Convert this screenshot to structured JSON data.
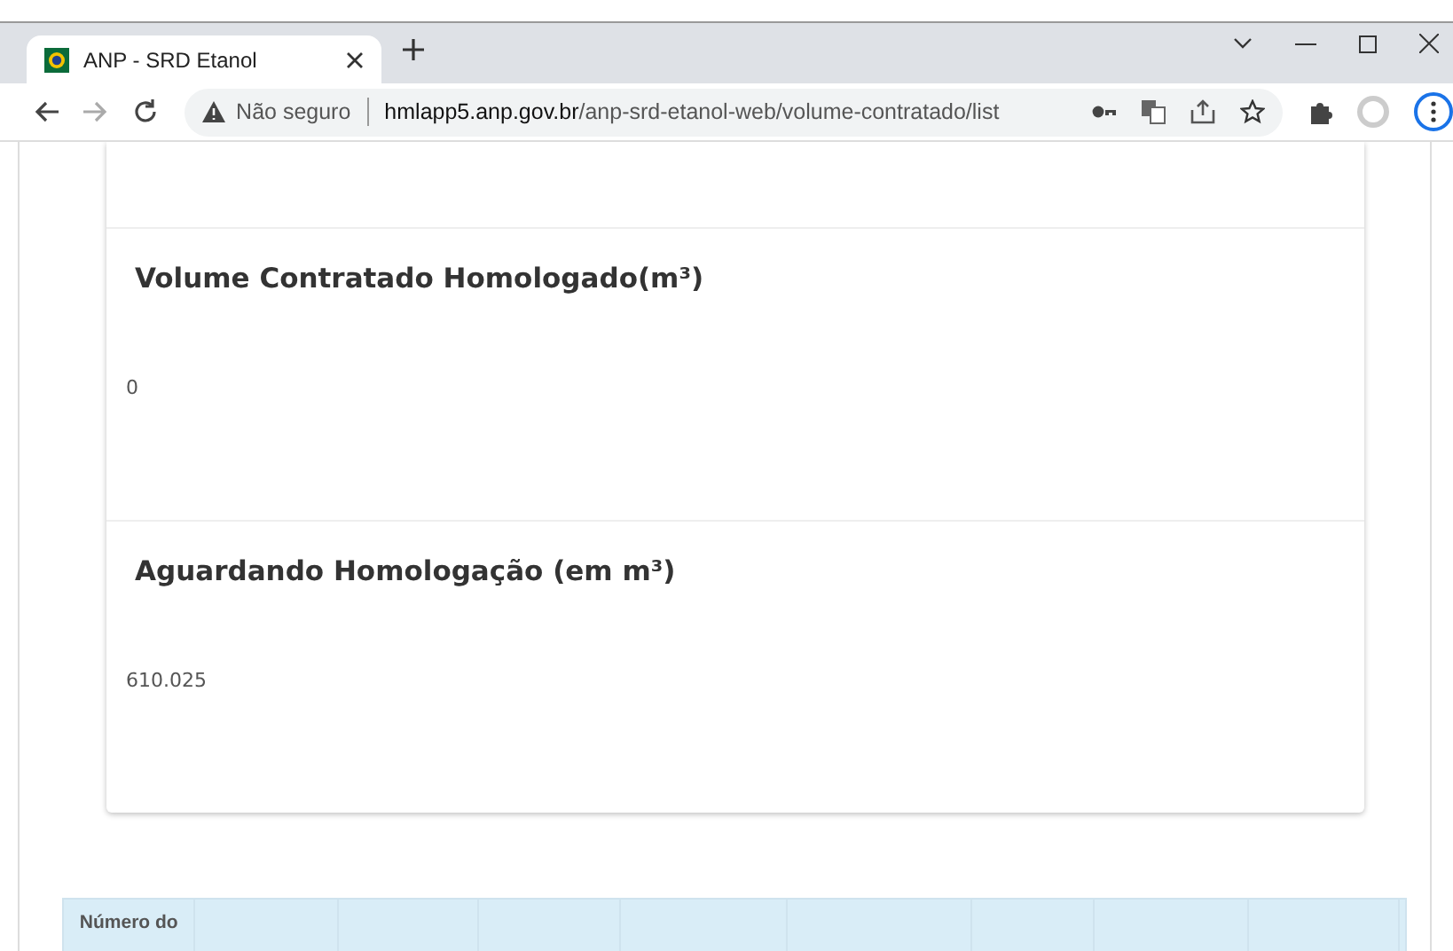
{
  "browser": {
    "tab": {
      "title": "ANP - SRD Etanol",
      "selected": true
    },
    "nav": [
      {
        "kind": "back",
        "disabled": false
      },
      {
        "kind": "forward",
        "disabled": true
      },
      {
        "kind": "reload",
        "disabled": false
      }
    ],
    "address": {
      "security": "Não seguro",
      "host": "hmlapp5.anp.gov.br",
      "path": "/anp-srd-etanol-web/volume-contratado/list"
    }
  },
  "cards": [
    {
      "title": "Volume Contratado Homologado(m³)",
      "value": "0"
    },
    {
      "title": "Aguardando Homologação (em m³)",
      "value": "610.025"
    }
  ],
  "table": {
    "columns": [
      {
        "label": "Número do"
      },
      {},
      {},
      {},
      {},
      {},
      {},
      {},
      {},
      {}
    ]
  }
}
